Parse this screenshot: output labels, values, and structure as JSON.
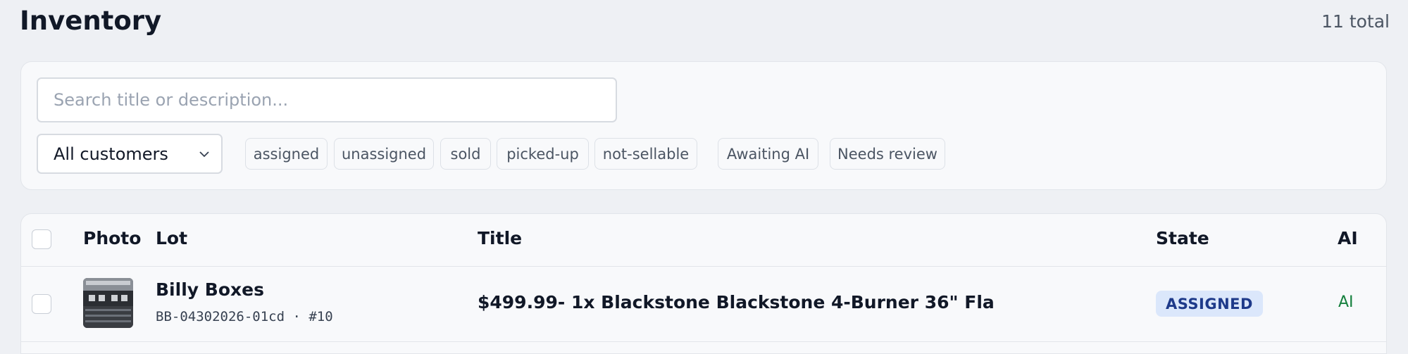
{
  "header": {
    "title": "Inventory",
    "total": "11 total"
  },
  "filters": {
    "search_placeholder": "Search title or description...",
    "customer_select": "All customers",
    "state_chips": [
      "assigned",
      "unassigned",
      "sold",
      "picked-up",
      "not-sellable"
    ],
    "ai_chips": [
      "Awaiting AI",
      "Needs review"
    ]
  },
  "table": {
    "columns": {
      "photo": "Photo",
      "lot": "Lot",
      "title": "Title",
      "state": "State",
      "ai": "AI"
    },
    "rows": [
      {
        "lot_name": "Billy Boxes",
        "lot_code": "BB-04302026-01cd · #10",
        "title": "$499.99- 1x Blackstone Blackstone 4-Burner 36\" Fla",
        "state": "ASSIGNED",
        "ai": "AI"
      }
    ]
  },
  "colors": {
    "accent_badge_bg": "#dbe7fb",
    "accent_badge_text": "#1e3a8a",
    "ai_green": "#15803d"
  }
}
